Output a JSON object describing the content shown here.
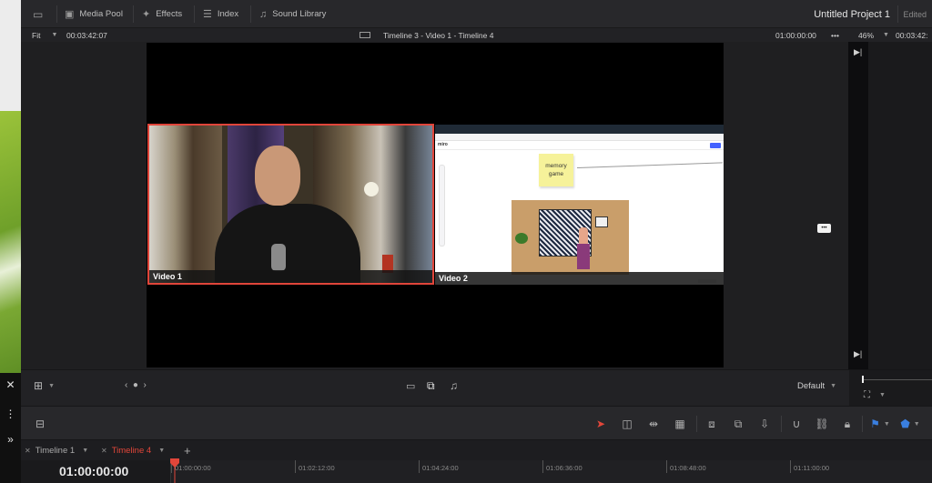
{
  "toolbar": {
    "media_pool": "Media Pool",
    "effects": "Effects",
    "index": "Index",
    "sound_library": "Sound Library",
    "project_title": "Untitled Project 1",
    "project_status": "Edited"
  },
  "viewer": {
    "zoom": "Fit",
    "source_timecode": "00:03:42:07",
    "timeline_title": "Timeline 3 - Video 1 - Timeline 4",
    "record_timecode": "01:00:00:00",
    "more": "•••",
    "right_zoom": "46%",
    "right_timecode": "00:03:42:"
  },
  "clips": {
    "video1_label": "Video 1",
    "video2_label": "Video 2",
    "sticky_text": "memory game",
    "brand": "miro"
  },
  "controls": {
    "default_label": "Default"
  },
  "tabs": [
    {
      "label": "Timeline 1",
      "active": false
    },
    {
      "label": "Timeline 4",
      "active": true
    }
  ],
  "timeline": {
    "timecode": "01:00:00:00",
    "ticks": [
      "01:00:00:00",
      "01:02:12:00",
      "01:04:24:00",
      "01:06:36:00",
      "01:08:48:00",
      "01:11:00:00"
    ]
  },
  "colors": {
    "accent_red": "#e0453a",
    "flag_blue": "#3a7fe0"
  }
}
